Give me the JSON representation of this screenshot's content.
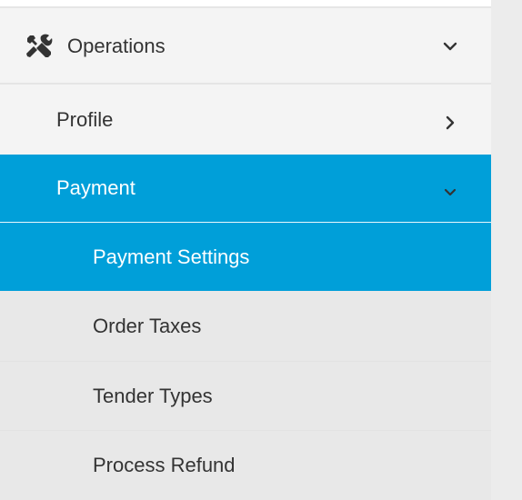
{
  "nav": {
    "operations": {
      "label": "Operations",
      "icon": "tools-icon",
      "chevron": "chevron-down-icon"
    },
    "profile": {
      "label": "Profile",
      "chevron": "chevron-right-icon"
    },
    "payment": {
      "label": "Payment",
      "chevron": "chevron-down-icon",
      "active": true
    },
    "payment_children": [
      {
        "label": "Payment Settings",
        "active": true
      },
      {
        "label": "Order Taxes",
        "active": false
      },
      {
        "label": "Tender Types",
        "active": false
      },
      {
        "label": "Process Refund",
        "active": false
      }
    ]
  },
  "colors": {
    "accent": "#009fd9",
    "text": "#333333",
    "active_text": "#ffffff",
    "sidebar_bg": "#f4f4f4",
    "submenu_bg": "#e8e8e8"
  }
}
